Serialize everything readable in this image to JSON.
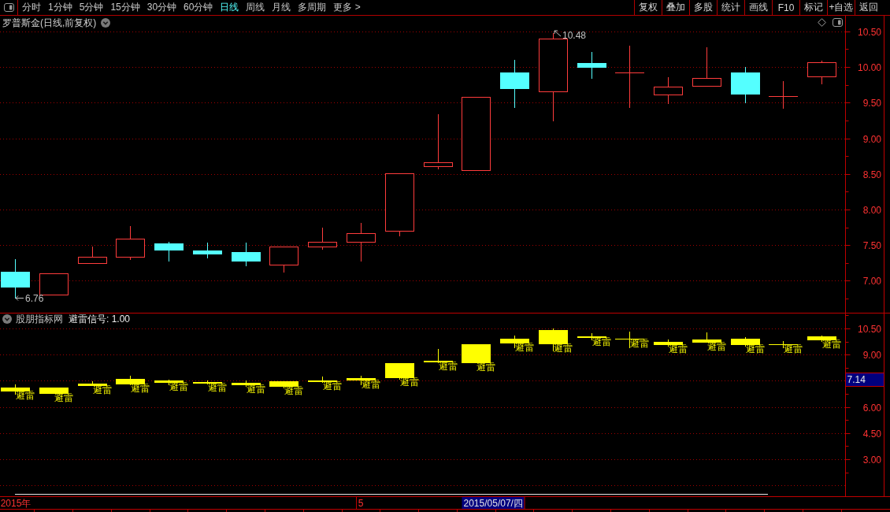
{
  "toolbar": {
    "periods": [
      {
        "label": "分时",
        "selected": false
      },
      {
        "label": "1分钟",
        "selected": false
      },
      {
        "label": "5分钟",
        "selected": false
      },
      {
        "label": "15分钟",
        "selected": false
      },
      {
        "label": "30分钟",
        "selected": false
      },
      {
        "label": "60分钟",
        "selected": false
      },
      {
        "label": "日线",
        "selected": true
      },
      {
        "label": "周线",
        "selected": false
      },
      {
        "label": "月线",
        "selected": false
      },
      {
        "label": "多周期",
        "selected": false
      },
      {
        "label": "更多 >",
        "selected": false
      }
    ],
    "buttons": [
      "复权",
      "叠加",
      "多股",
      "统计",
      "画线",
      "F10",
      "标记",
      "+自选",
      "返回"
    ]
  },
  "price_panel": {
    "title": "罗普斯金(日线,前复权)",
    "chart_data": [
      {
        "type": "candlestick",
        "colors": [
          "#54ffff",
          "#ff3c3c",
          "#ff3c3c",
          "#ff3c3c",
          "#54ffff",
          "#54ffff",
          "#54ffff",
          "#ff3c3c",
          "#ff3c3c",
          "#ff3c3c",
          "#ff3c3c",
          "#ff3c3c",
          "#ff3c3c",
          "#54ffff",
          "#ff3c3c",
          "#54ffff",
          "#ff3c3c",
          "#ff3c3c",
          "#ff3c3c",
          "#54ffff",
          "#ff3c3c",
          "#ff3c3c"
        ],
        "grid": true,
        "ylim": [
          6.55,
          10.72
        ],
        "yticks": [
          {
            "value": 7,
            "label": "7.00"
          },
          {
            "value": 7.5,
            "label": "7.50"
          },
          {
            "value": 8,
            "label": "8.00"
          },
          {
            "value": 8.5,
            "label": "8.50"
          },
          {
            "value": 9,
            "label": "9.00"
          },
          {
            "value": 9.5,
            "label": "9.50"
          },
          {
            "value": 10,
            "label": "10.00"
          },
          {
            "value": 10.5,
            "label": "10.50"
          }
        ],
        "ohlc": [
          [
            7.12,
            7.3,
            6.76,
            6.92
          ],
          [
            6.8,
            7.1,
            6.8,
            7.1
          ],
          [
            7.25,
            7.48,
            7.25,
            7.34
          ],
          [
            7.34,
            7.77,
            7.3,
            7.59
          ],
          [
            7.52,
            7.55,
            7.28,
            7.43
          ],
          [
            7.42,
            7.53,
            7.32,
            7.38
          ],
          [
            7.4,
            7.53,
            7.21,
            7.28
          ],
          [
            7.22,
            7.48,
            7.13,
            7.48
          ],
          [
            7.48,
            7.74,
            7.45,
            7.54
          ],
          [
            7.55,
            7.81,
            7.28,
            7.67
          ],
          [
            7.7,
            8.51,
            7.63,
            8.51
          ],
          [
            8.61,
            9.34,
            8.57,
            8.66
          ],
          [
            8.55,
            9.58,
            8.55,
            9.58
          ],
          [
            9.92,
            10.1,
            9.44,
            9.7
          ],
          [
            9.66,
            10.48,
            9.25,
            10.4
          ],
          [
            10.06,
            10.21,
            9.85,
            10.0
          ],
          [
            9.92,
            10.3,
            9.44,
            9.92
          ],
          [
            9.61,
            9.86,
            9.49,
            9.72
          ],
          [
            9.74,
            10.28,
            9.74,
            9.85
          ],
          [
            9.92,
            10.0,
            9.5,
            9.62
          ],
          [
            9.59,
            9.8,
            9.43,
            9.59
          ],
          [
            9.87,
            10.09,
            9.77,
            10.07
          ]
        ],
        "annotations": [
          "10.48",
          "6.76"
        ]
      }
    ]
  },
  "indicator_panel": {
    "name": "股朋指标网",
    "signal": "避雷信号: 1.00",
    "cursor": {
      "value": "7.14",
      "date": "2015/05/07/四"
    },
    "chart_data": [
      {
        "type": "candlestick",
        "color": "#ffff00",
        "grid": true,
        "ylim": [
          0.88,
          11.36
        ],
        "yticks": [
          {
            "value": 3,
            "label": "3.00"
          },
          {
            "value": 4.5,
            "label": "4.50"
          },
          {
            "value": 6,
            "label": "6.00"
          },
          {
            "value": 9,
            "label": "9.00"
          },
          {
            "value": 10.5,
            "label": "10.50"
          }
        ],
        "categories": [
          "2015年",
          null,
          null,
          null,
          null,
          null,
          null,
          null,
          null,
          "5",
          null,
          null,
          null,
          null,
          null,
          null,
          null,
          null,
          null,
          null,
          null,
          null
        ],
        "ohlc": [
          [
            6.92,
            7.3,
            6.76,
            7.12
          ],
          [
            6.8,
            7.1,
            6.8,
            7.1
          ],
          [
            7.25,
            7.48,
            7.25,
            7.34
          ],
          [
            7.34,
            7.77,
            7.3,
            7.59
          ],
          [
            7.43,
            7.55,
            7.28,
            7.52
          ],
          [
            7.38,
            7.53,
            7.32,
            7.42
          ],
          [
            7.28,
            7.53,
            7.21,
            7.4
          ],
          [
            7.22,
            7.48,
            7.13,
            7.48
          ],
          [
            7.48,
            7.74,
            7.45,
            7.54
          ],
          [
            7.55,
            7.81,
            7.28,
            7.67
          ],
          [
            7.7,
            8.51,
            7.63,
            8.51
          ],
          [
            8.61,
            9.34,
            8.57,
            8.66
          ],
          [
            8.55,
            9.58,
            8.55,
            9.58
          ],
          [
            9.7,
            10.1,
            9.44,
            9.92
          ],
          [
            9.66,
            10.48,
            9.25,
            10.4
          ],
          [
            10.0,
            10.21,
            9.85,
            10.06
          ],
          [
            9.92,
            10.3,
            9.44,
            9.92
          ],
          [
            9.61,
            9.86,
            9.49,
            9.72
          ],
          [
            9.74,
            10.28,
            9.74,
            9.85
          ],
          [
            9.62,
            10.0,
            9.5,
            9.92
          ],
          [
            9.59,
            9.8,
            9.43,
            9.59
          ],
          [
            9.87,
            10.09,
            9.77,
            10.07
          ]
        ],
        "annotations": [
          "避雷",
          "避雷",
          "避雷",
          "避雷",
          "避雷",
          "避雷",
          "避雷",
          "避雷",
          "避雷",
          "避雷",
          "避雷",
          "避雷",
          "避雷",
          "避雷",
          "避雷",
          "避雷",
          "避雷",
          "避雷",
          "避雷",
          "避雷",
          "避雷",
          "避雷"
        ]
      }
    ]
  }
}
